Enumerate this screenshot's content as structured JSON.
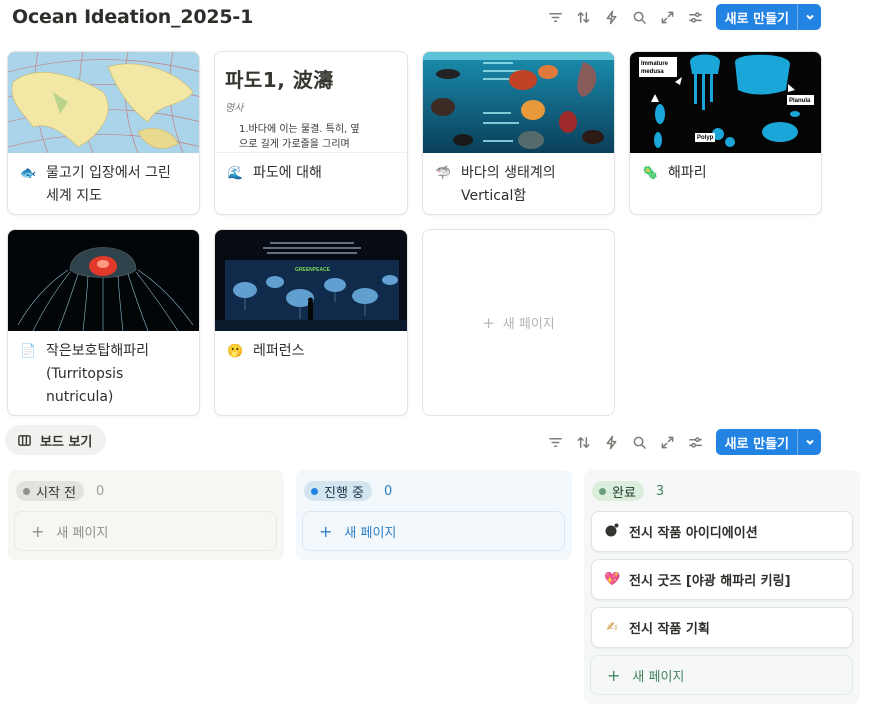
{
  "page": {
    "title": "Ocean Ideation_2025-1"
  },
  "toolbar": {
    "icons": [
      "filter-icon",
      "sort-icon",
      "lightning-icon",
      "search-icon",
      "expand-icon",
      "settings-sliders-icon"
    ],
    "new_label": "새로 만들기"
  },
  "gallery": {
    "cards": [
      {
        "title": "물고기 입장에서 그린\n세계 지도",
        "icon": "🐟"
      },
      {
        "title": "파도에 대해",
        "icon": "🌊",
        "cover_heading": "파도1, 波濤",
        "cover_sub": "명사",
        "cover_line": "1.바다에 이는 물결. 특히, 옆\n으로 길게 가로줄을 그리며"
      },
      {
        "title": "바다의 생태계의\nVertical함",
        "icon": "🦈"
      },
      {
        "title": "해파리",
        "icon": "🦠"
      },
      {
        "title": "작은보호탑해파리\n(Turritopsis\nnutricula)",
        "icon": "📄"
      },
      {
        "title": "레퍼런스",
        "icon": "🫢"
      }
    ],
    "cover_labels": {
      "immature": "Immature\nmedusa",
      "planula": "Planula",
      "polyp": "Polyp",
      "brand": "GREENPEACE"
    },
    "new_page_label": "새 페이지"
  },
  "board": {
    "view_label": "보드 보기",
    "new_label": "새로 만들기",
    "columns": [
      {
        "name": "시작 전",
        "count": "0",
        "new_label": "새 페이지",
        "cards": []
      },
      {
        "name": "진행 중",
        "count": "0",
        "new_label": "새 페이지",
        "cards": []
      },
      {
        "name": "완료",
        "count": "3",
        "new_label": "새 페이지",
        "cards": [
          {
            "title": "전시 작품 아이디에이션",
            "icon": "●"
          },
          {
            "title": "전시 굿즈 [야광 해파리 키링]",
            "icon": "💖"
          },
          {
            "title": "전시 작품 기획",
            "icon": "✍"
          }
        ]
      }
    ]
  },
  "colors": {
    "accent": "#2383e2",
    "todo_bg": "#f7f6f3",
    "todo_pill": "#e3e2e0",
    "todo_dot": "#91918e",
    "progress_bg": "#f3f8fc",
    "progress_pill": "#d3e5ef",
    "progress_dot": "#2383e2",
    "done_bg": "#f5f8f6",
    "done_pill": "#dbeddb",
    "done_dot": "#6c9b7d",
    "done_text": "#448361"
  }
}
